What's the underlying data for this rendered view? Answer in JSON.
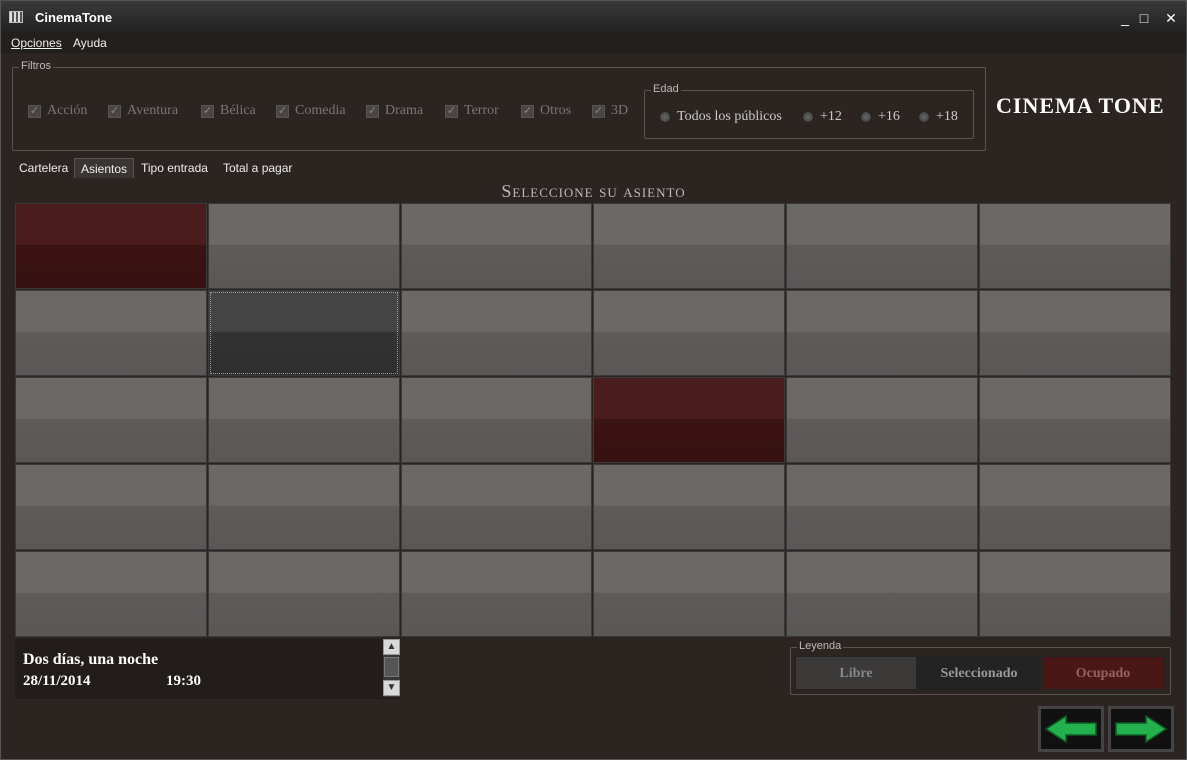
{
  "window": {
    "title": "CinemaTone",
    "controls": [
      "_",
      "□",
      "✕"
    ]
  },
  "menu": {
    "opciones": "Opciones",
    "ayuda": "Ayuda"
  },
  "filters": {
    "group_title": "Filtros",
    "genres": [
      {
        "label": "Acción",
        "checked": true
      },
      {
        "label": "Aventura",
        "checked": true
      },
      {
        "label": "Bélica",
        "checked": true
      },
      {
        "label": "Comedia",
        "checked": true
      },
      {
        "label": "Drama",
        "checked": true
      },
      {
        "label": "Terror",
        "checked": true
      },
      {
        "label": "Otros",
        "checked": true
      },
      {
        "label": "3D",
        "checked": true
      }
    ],
    "age": {
      "group_title": "Edad",
      "options": [
        "Todos los públicos",
        "+12",
        "+16",
        "+18"
      ]
    }
  },
  "brand": "CINEMA TONE",
  "tabs": [
    "Cartelera",
    "Asientos",
    "Tipo entrada",
    "Total a pagar"
  ],
  "active_tab": "Asientos",
  "seat_heading": "Seleccione su asiento",
  "seats": {
    "rows": 5,
    "cols": 6,
    "states": [
      [
        "ocupado",
        "libre",
        "libre",
        "libre",
        "libre",
        "libre"
      ],
      [
        "libre",
        "seleccionado",
        "libre",
        "libre",
        "libre",
        "libre"
      ],
      [
        "libre",
        "libre",
        "libre",
        "ocupado",
        "libre",
        "libre"
      ],
      [
        "libre",
        "libre",
        "libre",
        "libre",
        "libre",
        "libre"
      ],
      [
        "libre",
        "libre",
        "libre",
        "libre",
        "libre",
        "libre"
      ]
    ]
  },
  "session": {
    "movie": "Dos días, una noche",
    "date": "28/11/2014",
    "time": "19:30"
  },
  "legend": {
    "group_title": "Leyenda",
    "libre": "Libre",
    "seleccionado": "Seleccionado",
    "ocupado": "Ocupado"
  },
  "colors": {
    "seat_free": "#6b6866",
    "seat_occupied": "#4a1c1c",
    "seat_selected": "#444444",
    "nav_arrow": "#22b14c"
  },
  "icons": {
    "back": "arrow-left-icon",
    "next": "arrow-right-icon"
  }
}
